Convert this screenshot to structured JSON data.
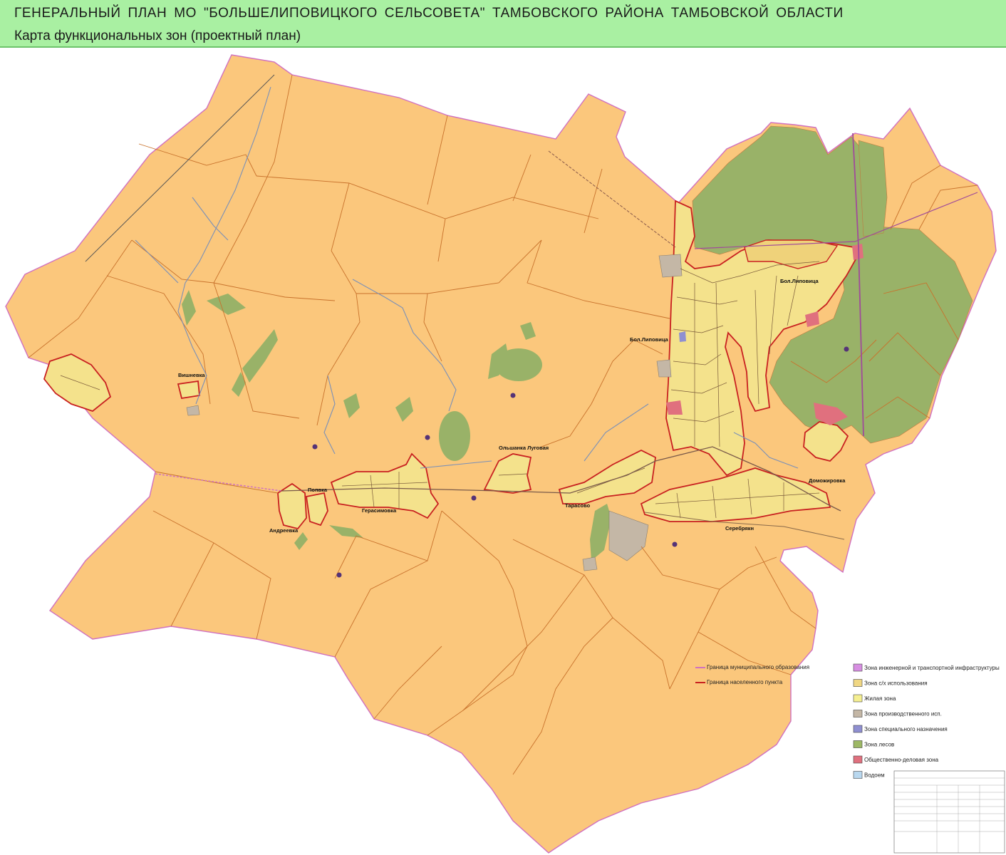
{
  "header": {
    "title": "ГЕНЕРАЛЬНЫЙ ПЛАН МО \"БОЛЬШЕЛИПОВИЦКОГО СЕЛЬСОВЕТА\" ТАМБОВСКОГО РАЙОНА ТАМБОВСКОЙ ОБЛАСТИ",
    "subtitle": "Карта функциональных зон (проектный план)"
  },
  "settlements": [
    "Вишневка",
    "Попвка",
    "Андреевка",
    "Герасимовка",
    "Ольшанка Луговая",
    "Тарасово",
    "Серебрякн",
    "Доможировка",
    "Бол.Липовица",
    "Бол.Липовица"
  ],
  "legend": {
    "lines": [
      {
        "label": "Граница муниципального образования",
        "color": "#d070c0"
      },
      {
        "label": "Граница населенного пункта",
        "color": "#c82020"
      }
    ],
    "zones": [
      {
        "label": "Зона инженерной и транспортной инфраструктуры",
        "color": "#d78ee2"
      },
      {
        "label": "Зона с/х использования",
        "color": "#f0d783"
      },
      {
        "label": "Жилая зона",
        "color": "#f5ef91"
      },
      {
        "label": "Зона производственного исп.",
        "color": "#c4b7a6"
      },
      {
        "label": "Зона специального назначения",
        "color": "#8f8fd1"
      },
      {
        "label": "Зона лесов",
        "color": "#9db865"
      },
      {
        "label": "Общественно-деловая зона",
        "color": "#e0707e"
      },
      {
        "label": "Водоем",
        "color": "#b9d8ef"
      }
    ]
  },
  "colors": {
    "header_bg": "#a9f0a2",
    "agri_land": "#fbc77c",
    "forest": "#99b268",
    "residential": "#f4e28c",
    "boundary": "#c82020",
    "mo_boundary": "#d070c0"
  }
}
